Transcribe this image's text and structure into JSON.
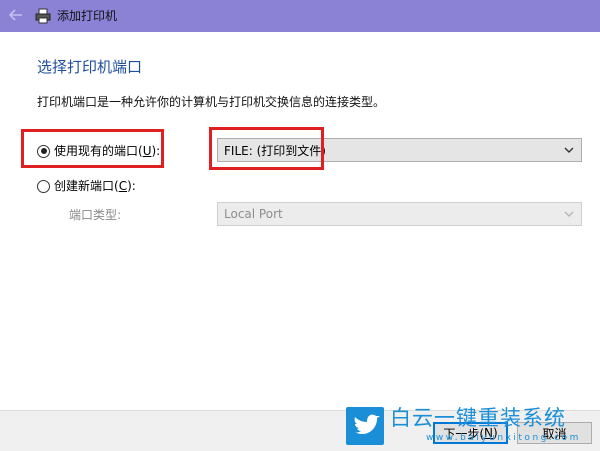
{
  "window": {
    "title": "添加打印机"
  },
  "page": {
    "heading": "选择打印机端口",
    "description": "打印机端口是一种允许你的计算机与打印机交换信息的连接类型。"
  },
  "existing_port": {
    "label_prefix": "使用现有的端口(",
    "accel": "U",
    "label_suffix": "):",
    "selected": true,
    "value": "FILE: (打印到文件)"
  },
  "new_port": {
    "label_prefix": "创建新端口(",
    "accel": "C",
    "label_suffix": "):",
    "selected": false,
    "type_label": "端口类型:",
    "type_value": "Local Port"
  },
  "buttons": {
    "next_prefix": "下一步(",
    "next_accel": "N",
    "next_suffix": ")",
    "cancel": "取消"
  },
  "watermark": {
    "title": "白云一键重装系统",
    "url": "www.baiyunxitong.com"
  },
  "colors": {
    "titlebar": "#8b82d6",
    "heading": "#1f4e9c",
    "highlight_box": "#e02020",
    "watermark": "#1a8fd8"
  },
  "icons": {
    "back": "back-arrow-icon",
    "printer": "printer-icon",
    "dropdown": "chevron-down-icon",
    "logo": "bird-logo-icon"
  }
}
